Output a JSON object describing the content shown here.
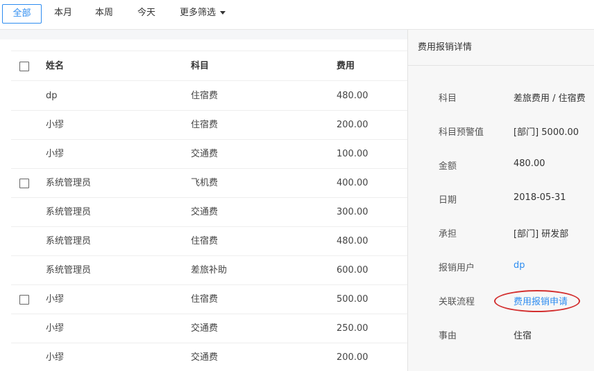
{
  "filters": {
    "all": "全部",
    "month": "本月",
    "week": "本周",
    "today": "今天",
    "more": "更多筛选"
  },
  "table": {
    "headers": {
      "name": "姓名",
      "subject": "科目",
      "cost": "费用"
    },
    "rows": [
      {
        "name": "dp",
        "subject": "住宿费",
        "cost": "480.00",
        "checkbox": false
      },
      {
        "name": "小缪",
        "subject": "住宿费",
        "cost": "200.00",
        "checkbox": false
      },
      {
        "name": "小缪",
        "subject": "交通费",
        "cost": "100.00",
        "checkbox": false
      },
      {
        "name": "系统管理员",
        "subject": "飞机费",
        "cost": "400.00",
        "checkbox": true
      },
      {
        "name": "系统管理员",
        "subject": "交通费",
        "cost": "300.00",
        "checkbox": false
      },
      {
        "name": "系统管理员",
        "subject": "住宿费",
        "cost": "480.00",
        "checkbox": false
      },
      {
        "name": "系统管理员",
        "subject": "差旅补助",
        "cost": "600.00",
        "checkbox": false
      },
      {
        "name": "小缪",
        "subject": "住宿费",
        "cost": "500.00",
        "checkbox": true
      },
      {
        "name": "小缪",
        "subject": "交通费",
        "cost": "250.00",
        "checkbox": false
      },
      {
        "name": "小缪",
        "subject": "交通费",
        "cost": "200.00",
        "checkbox": false
      }
    ]
  },
  "detail": {
    "title": "费用报销详情",
    "fields": [
      {
        "label": "科目",
        "value": "差旅费用 / 住宿费"
      },
      {
        "label": "科目预警值",
        "value": "[部门] 5000.00"
      },
      {
        "label": "金额",
        "value": "480.00"
      },
      {
        "label": "日期",
        "value": "2018-05-31"
      },
      {
        "label": "承担",
        "value": "[部门] 研发部"
      },
      {
        "label": "报销用户",
        "value": "dp"
      },
      {
        "label": "关联流程",
        "value": "费用报销申请"
      },
      {
        "label": "事由",
        "value": "住宿"
      }
    ]
  },
  "colors": {
    "accent": "#2d8cf0",
    "highlight": "#d32f2f"
  }
}
